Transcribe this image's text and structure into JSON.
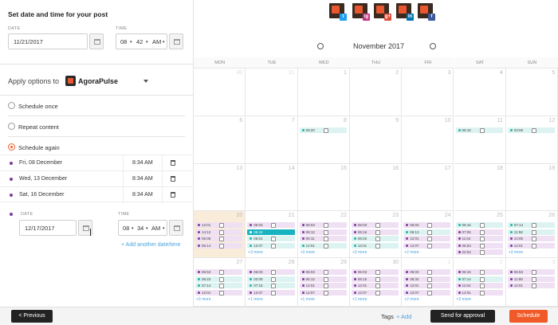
{
  "left": {
    "title": "Set date and time for your post",
    "date_label": "DATE",
    "date_value": "11/21/2017",
    "time_label": "TIME",
    "time_hour": "08",
    "time_min": "42",
    "time_ampm": "AM",
    "apply_label": "Apply options to",
    "account": "AgoraPulse",
    "options": [
      "Schedule once",
      "Repeat content",
      "Schedule again"
    ],
    "schedule_rows": [
      {
        "date": "Fri, 08 December",
        "time": "8:34 AM"
      },
      {
        "date": "Wed, 13 December",
        "time": "8:34 AM"
      },
      {
        "date": "Sat, 16 December",
        "time": "8:34 AM"
      }
    ],
    "new_date_label": "DATE",
    "new_date_value": "12/17/2017",
    "new_time_label": "TIME",
    "new_time_hour": "08",
    "new_time_min": "34",
    "new_time_ampm": "AM",
    "add_link": "+ Add another date/time"
  },
  "calendar": {
    "month": "November 2017",
    "days": [
      "MON",
      "TUE",
      "WED",
      "THU",
      "FRI",
      "SAT",
      "SUN"
    ],
    "weeks": [
      [
        {
          "n": "30",
          "o": true
        },
        {
          "n": "31",
          "o": true
        },
        {
          "n": "1"
        },
        {
          "n": "2"
        },
        {
          "n": "3"
        },
        {
          "n": "4"
        },
        {
          "n": "5"
        }
      ],
      [
        {
          "n": "6"
        },
        {
          "n": "7"
        },
        {
          "n": "8",
          "ev": [
            [
              "teal",
              "09:20"
            ]
          ]
        },
        {
          "n": "9"
        },
        {
          "n": "10"
        },
        {
          "n": "11",
          "ev": [
            [
              "teal",
              "06:15"
            ]
          ]
        },
        {
          "n": "12",
          "ev": [
            [
              "teal",
              "03:09"
            ]
          ]
        }
      ],
      [
        {
          "n": "13"
        },
        {
          "n": "14"
        },
        {
          "n": "15"
        },
        {
          "n": "16"
        },
        {
          "n": "17"
        },
        {
          "n": "18"
        },
        {
          "n": "19"
        }
      ],
      [
        {
          "n": "20",
          "today": true,
          "ev": [
            [
              "purple",
              "12:01"
            ],
            [
              "purple",
              "14:12"
            ],
            [
              "purple",
              "06:06"
            ],
            [
              "purple",
              "06:14"
            ]
          ]
        },
        {
          "n": "21",
          "ev": [
            [
              "purple",
              "06:03"
            ],
            [
              "sel",
              "08:42"
            ],
            [
              "teal",
              "06:01"
            ],
            [
              "teal",
              "12:07"
            ]
          ],
          "more": "+3 more"
        },
        {
          "n": "22",
          "ev": [
            [
              "purple",
              "06:03"
            ],
            [
              "purple",
              "06:12"
            ],
            [
              "purple",
              "06:11"
            ],
            [
              "teal",
              "12:01"
            ]
          ],
          "more": "+3 more"
        },
        {
          "n": "23",
          "ev": [
            [
              "purple",
              "06:03"
            ],
            [
              "purple",
              "06:16"
            ],
            [
              "teal",
              "06:02"
            ],
            [
              "teal",
              "12:01"
            ]
          ],
          "more": "+3 more"
        },
        {
          "n": "24",
          "ev": [
            [
              "purple",
              "06:03"
            ],
            [
              "teal",
              "06:13"
            ],
            [
              "purple",
              "12:01"
            ],
            [
              "purple",
              "12:07"
            ]
          ],
          "more": "+2 more"
        },
        {
          "n": "25",
          "ev": [
            [
              "teal",
              "06:15"
            ],
            [
              "purple",
              "07:05"
            ],
            [
              "purple",
              "11:54"
            ],
            [
              "purple",
              "06:53"
            ],
            [
              "purple",
              "22:04"
            ]
          ]
        },
        {
          "n": "26",
          "ev": [
            [
              "teal",
              "07:14"
            ],
            [
              "teal",
              "11:58"
            ],
            [
              "purple",
              "14:05"
            ],
            [
              "purple",
              "12:01"
            ]
          ],
          "more": "+3 more"
        }
      ],
      [
        {
          "n": "27",
          "ev": [
            [
              "purple",
              "06:53"
            ],
            [
              "teal",
              "06:23"
            ],
            [
              "teal",
              "07:14"
            ],
            [
              "purple",
              "12:01"
            ]
          ],
          "more": "+3 more"
        },
        {
          "n": "28",
          "ev": [
            [
              "purple",
              "06:03"
            ],
            [
              "teal",
              "03:09"
            ],
            [
              "teal",
              "07:15"
            ],
            [
              "purple",
              "12:07"
            ]
          ],
          "more": "+1 more"
        },
        {
          "n": "29",
          "ev": [
            [
              "purple",
              "06:03"
            ],
            [
              "purple",
              "06:12"
            ],
            [
              "purple",
              "12:01"
            ],
            [
              "purple",
              "12:07"
            ]
          ],
          "more": "+1 more"
        },
        {
          "n": "30",
          "ev": [
            [
              "purple",
              "06:03"
            ],
            [
              "purple",
              "06:15"
            ],
            [
              "purple",
              "12:01"
            ],
            [
              "purple",
              "12:07"
            ]
          ],
          "more": "+1 more"
        },
        {
          "n": "1",
          "o": true,
          "ev": [
            [
              "purple",
              "06:03"
            ],
            [
              "purple",
              "08:34"
            ],
            [
              "purple",
              "12:01"
            ],
            [
              "purple",
              "12:07"
            ]
          ],
          "more": "+2 more"
        },
        {
          "n": "2",
          "o": true,
          "ev": [
            [
              "purple",
              "06:15"
            ],
            [
              "teal",
              "07:14"
            ],
            [
              "purple",
              "11:54"
            ],
            [
              "purple",
              "12:01"
            ]
          ],
          "more": "+3 more"
        },
        {
          "n": "3",
          "o": true,
          "ev": [
            [
              "purple",
              "06:53"
            ],
            [
              "purple",
              "11:58"
            ],
            [
              "purple",
              "12:01"
            ]
          ]
        }
      ]
    ]
  },
  "socials": [
    {
      "badge": "t",
      "color": "#1da1f2"
    },
    {
      "badge": "ig",
      "color": "#c13584"
    },
    {
      "badge": "g+",
      "color": "#dd4b39"
    },
    {
      "badge": "in",
      "color": "#0077b5"
    },
    {
      "badge": "f",
      "color": "#3b5998"
    }
  ],
  "footer": {
    "prev": "< Previous",
    "tags": "Tags",
    "add_tag": "+ Add",
    "approval": "Send for approval",
    "schedule": "Schedule"
  }
}
